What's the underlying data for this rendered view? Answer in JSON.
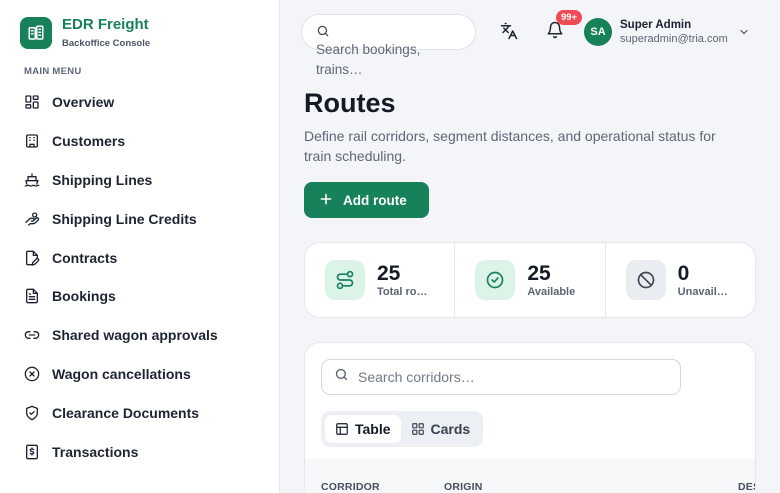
{
  "brand": {
    "name": "EDR Freight",
    "subtitle": "Backoffice Console"
  },
  "sidebar": {
    "heading": "MAIN MENU",
    "items": [
      {
        "label": "Overview",
        "icon": "grid-icon"
      },
      {
        "label": "Customers",
        "icon": "building-icon"
      },
      {
        "label": "Shipping Lines",
        "icon": "ship-icon"
      },
      {
        "label": "Shipping Line Credits",
        "icon": "hand-coins-icon"
      },
      {
        "label": "Contracts",
        "icon": "file-pen-icon"
      },
      {
        "label": "Bookings",
        "icon": "file-text-icon"
      },
      {
        "label": "Shared wagon approvals",
        "icon": "link-icon"
      },
      {
        "label": "Wagon cancellations",
        "icon": "circle-x-icon"
      },
      {
        "label": "Clearance Documents",
        "icon": "shield-check-icon"
      },
      {
        "label": "Transactions",
        "icon": "receipt-dollar-icon"
      }
    ]
  },
  "topbar": {
    "search_placeholder": "Search bookings, trains…",
    "notification_badge": "99+",
    "user": {
      "initials": "SA",
      "name": "Super Admin",
      "email": "superadmin@tria.com"
    }
  },
  "page": {
    "title": "Routes",
    "description": "Define rail corridors, segment distances, and operational status for train scheduling.",
    "add_button": "Add route"
  },
  "stats": [
    {
      "value": "25",
      "label": "Total ro…",
      "icon": "route-icon",
      "color": "#17815a"
    },
    {
      "value": "25",
      "label": "Available",
      "icon": "circle-check-icon",
      "color": "#17815a"
    },
    {
      "value": "0",
      "label": "Unavail…",
      "icon": "ban-icon",
      "color": "#3f4854"
    }
  ],
  "table": {
    "search_placeholder": "Search corridors…",
    "views": [
      "Table",
      "Cards"
    ],
    "active_view": "Table",
    "columns": [
      "CORRIDOR",
      "ORIGIN",
      "DES"
    ]
  }
}
